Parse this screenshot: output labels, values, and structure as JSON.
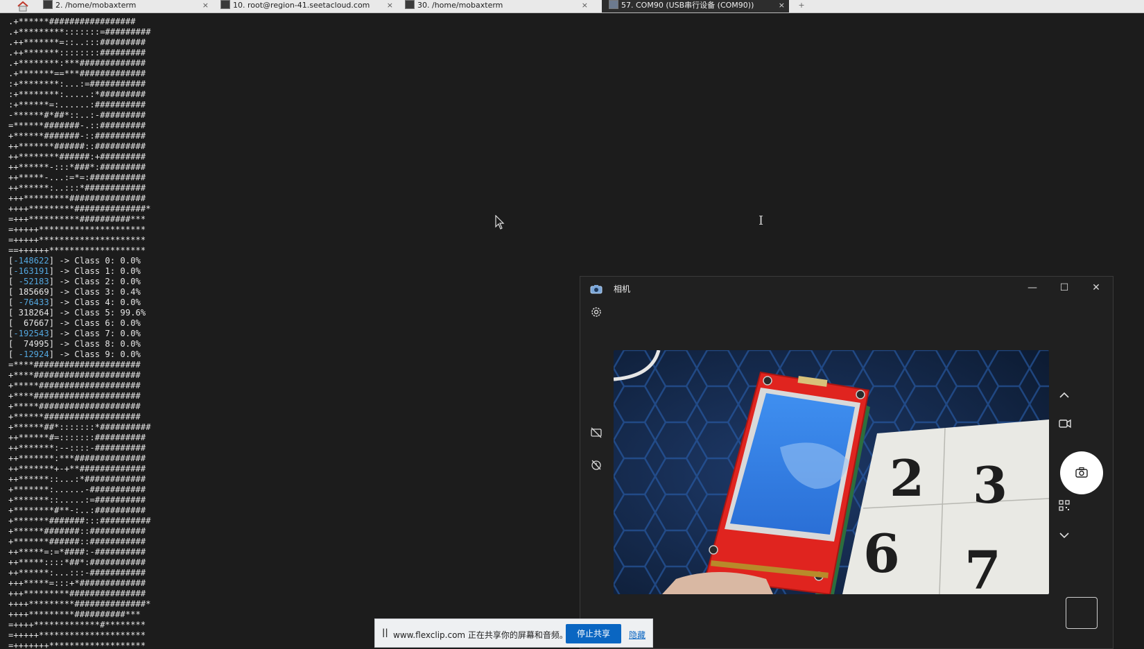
{
  "tabs": [
    {
      "label": "2. /home/mobaxterm",
      "active": false,
      "icon": "terminal-icon"
    },
    {
      "label": "10. root@region-41.seetacloud.com",
      "active": false,
      "icon": "terminal-icon"
    },
    {
      "label": "30. /home/mobaxterm",
      "active": false,
      "icon": "terminal-icon"
    },
    {
      "label": "57. COM90  (USB串行设备 (COM90))",
      "active": true,
      "icon": "serial-port-icon"
    }
  ],
  "close_glyph": "×",
  "plus_glyph": "+",
  "terminal": {
    "art_top": [
      ".+******#################",
      ".+*********:::::::=#########",
      ".++*******=::..:::#########",
      ".++*******::::::::#########",
      ".+********:***#############",
      ".+*******==***#############",
      ":+********:...:=###########",
      ":+********:.....:*#########",
      ":+******=:......:##########",
      "-******#*##*::..:-#########",
      "=******#######-.::#########",
      "+******#######-::##########",
      "++*******######::##########",
      "++********######:+#########",
      "++******-:::*###*:#########",
      "++*****-...:=*=:###########",
      "++******:..:::*############",
      "+++*********###############",
      "++++*********##############*",
      "=+++**********##########***",
      "=+++++*********************",
      "=+++++*********************",
      "==++++++*******************"
    ],
    "classes": [
      {
        "value": "-148622",
        "negative": true,
        "label": "Class 0: 0.0%"
      },
      {
        "value": "-163191",
        "negative": true,
        "label": "Class 1: 0.0%"
      },
      {
        "value": "-52183",
        "negative": true,
        "label": "Class 2: 0.0%"
      },
      {
        "value": "185669",
        "negative": false,
        "label": "Class 3: 0.4%"
      },
      {
        "value": "-76433",
        "negative": true,
        "label": "Class 4: 0.0%"
      },
      {
        "value": "318264",
        "negative": false,
        "label": "Class 5: 99.6%"
      },
      {
        "value": "67667",
        "negative": false,
        "label": "Class 6: 0.0%"
      },
      {
        "value": "-192543",
        "negative": true,
        "label": "Class 7: 0.0%"
      },
      {
        "value": "74995",
        "negative": false,
        "label": "Class 8: 0.0%"
      },
      {
        "value": "-12924",
        "negative": true,
        "label": "Class 9: 0.0%"
      }
    ],
    "art_bottom": [
      "=****#####################",
      "+****#####################",
      "+*****####################",
      "+****#####################",
      "+*****####################",
      "+******###################",
      "+******##*:::::::*##########",
      "++******#=:::::::##########",
      "++*******:--::::-##########",
      "++*******:***##############",
      "++*******+-+**#############",
      "++******::...:*############",
      "+*******:......-###########",
      "+*******::.....:=##########",
      "+********#**-:..:##########",
      "+*******#######:::##########",
      "+******#######::###########",
      "+*******######::###########",
      "++*****=:=*####:-##########",
      "++*****::::*##*:###########",
      "++******:...:::-###########",
      "+++*****=:::+*#############",
      "+++*********###############",
      "++++*********##############*",
      "++++*********##########***",
      "=++++*************#********",
      "=+++++*********************",
      "=+++++++*******************"
    ]
  },
  "camera": {
    "title": "相机",
    "app_icon": "camera-app-icon",
    "minimize_glyph": "—",
    "maximize_glyph": "☐",
    "close_glyph": "✕",
    "preview_digits": [
      "2",
      "3",
      "6",
      "7"
    ],
    "colors": {
      "shutter": "#ffffff",
      "board": "#e0241f",
      "lcd": "#3c86e6"
    }
  },
  "share_banner": {
    "pause_glyph": "||",
    "message": "www.flexclip.com 正在共享你的屏幕和音频。",
    "stop_label": "停止共享",
    "hide_label": "隐藏",
    "accent": "#0a66c2"
  }
}
